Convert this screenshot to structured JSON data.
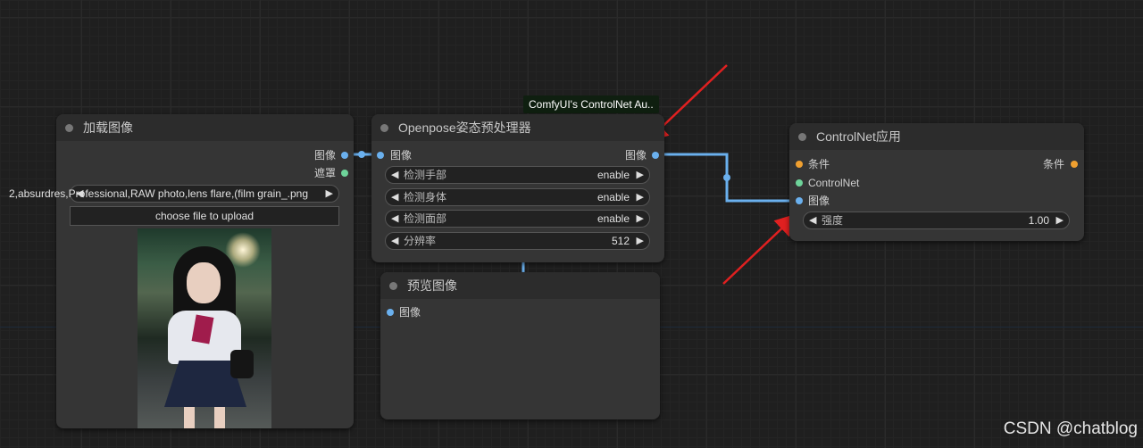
{
  "tooltip": {
    "text": "ComfyUI's ControlNet Au.."
  },
  "load_image_node": {
    "title": "加载图像",
    "outputs": [
      "图像",
      "遮罩"
    ],
    "image_widget_value": "2,absurdres,Professional,RAW photo,lens flare,(film grain_.png",
    "upload_label": "choose file to upload"
  },
  "openpose_node": {
    "title": "Openpose姿态预处理器",
    "input": "图像",
    "output": "图像",
    "widgets": [
      {
        "label": "检测手部",
        "value": "enable"
      },
      {
        "label": "检测身体",
        "value": "enable"
      },
      {
        "label": "检测面部",
        "value": "enable"
      },
      {
        "label": "分辨率",
        "value": "512"
      }
    ]
  },
  "preview_node": {
    "title": "预览图像",
    "input": "图像"
  },
  "controlnet_node": {
    "title": "ControlNet应用",
    "inputs": [
      "条件",
      "ControlNet",
      "图像"
    ],
    "output": "条件",
    "widget": {
      "label": "强度",
      "value": "1.00"
    }
  },
  "watermark": "CSDN @chatblog",
  "colors": {
    "image_link": "#6ab0ee",
    "conditioning": "#f0a030",
    "controlnet": "#6ed49a",
    "arrow": "#e02020"
  }
}
